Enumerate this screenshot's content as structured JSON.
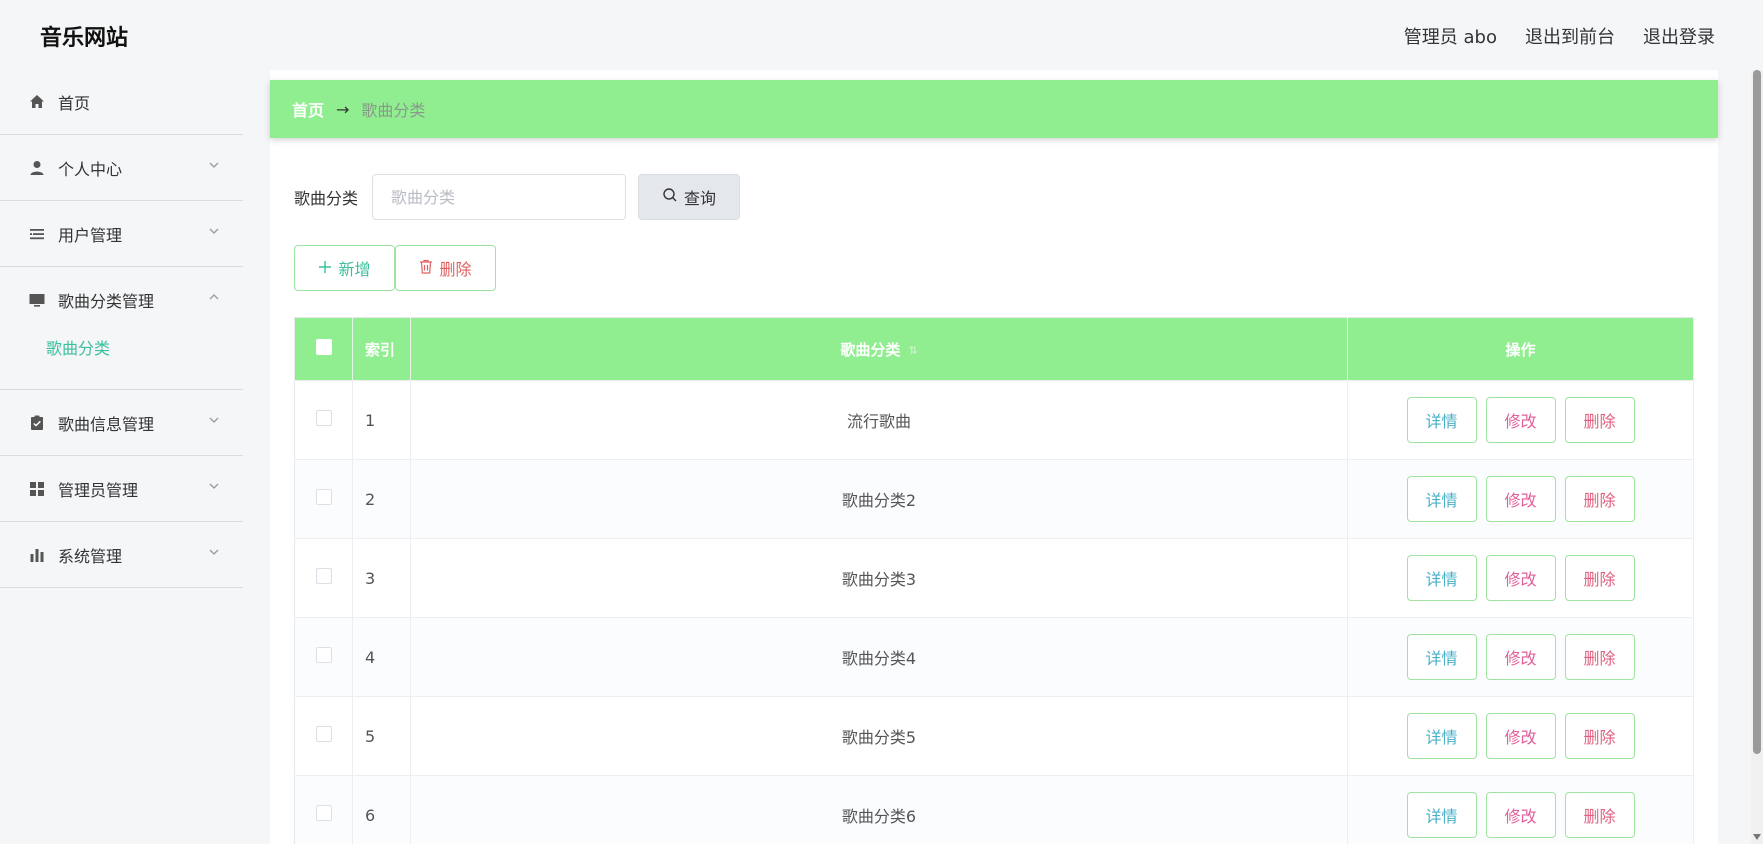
{
  "app": {
    "logo": "音乐网站"
  },
  "header": {
    "admin_label": "管理员 abo",
    "to_frontend": "退出到前台",
    "logout": "退出登录"
  },
  "sidebar": {
    "items": [
      {
        "label": "首页",
        "icon": "home-icon"
      },
      {
        "label": "个人中心",
        "icon": "user-icon"
      },
      {
        "label": "用户管理",
        "icon": "list-icon"
      },
      {
        "label": "歌曲分类管理",
        "icon": "monitor-icon"
      },
      {
        "label": "歌曲信息管理",
        "icon": "clipboard-icon"
      },
      {
        "label": "管理员管理",
        "icon": "grid-icon"
      },
      {
        "label": "系统管理",
        "icon": "bar-chart-icon"
      }
    ],
    "submenu": {
      "label": "歌曲分类"
    }
  },
  "breadcrumb": {
    "home": "首页",
    "arrow": "→",
    "current": "歌曲分类"
  },
  "search": {
    "label": "歌曲分类",
    "placeholder": "歌曲分类",
    "button": "查询"
  },
  "actions": {
    "add": "新增",
    "delete": "删除"
  },
  "table": {
    "headers": {
      "index": "索引",
      "category": "歌曲分类",
      "operation": "操作"
    },
    "rows": [
      {
        "index": "1",
        "category": "流行歌曲"
      },
      {
        "index": "2",
        "category": "歌曲分类2"
      },
      {
        "index": "3",
        "category": "歌曲分类3"
      },
      {
        "index": "4",
        "category": "歌曲分类4"
      },
      {
        "index": "5",
        "category": "歌曲分类5"
      },
      {
        "index": "6",
        "category": "歌曲分类6"
      }
    ],
    "row_actions": {
      "detail": "详情",
      "edit": "修改",
      "remove": "删除"
    }
  },
  "colors": {
    "accent_green": "#90ee90",
    "teal": "#3bbf9d"
  }
}
